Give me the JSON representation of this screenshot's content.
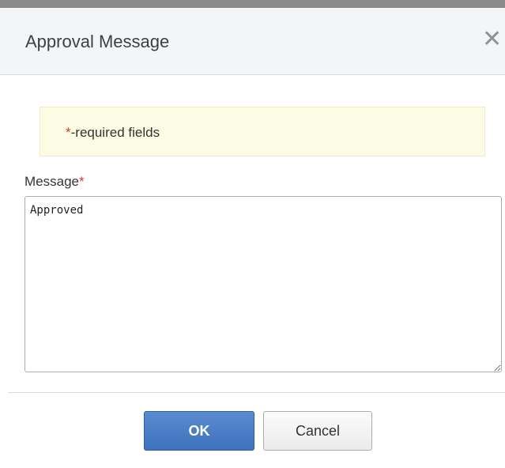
{
  "dialog": {
    "title": "Approval Message",
    "close_glyph": "✕",
    "close_icon": "close-icon"
  },
  "notice": {
    "asterisk": "*",
    "text": "-required fields"
  },
  "form": {
    "message_label": "Message",
    "required_marker": "*",
    "message_value": "Approved"
  },
  "buttons": {
    "ok_label": "OK",
    "cancel_label": "Cancel"
  },
  "colors": {
    "primary_button": "#4a7dc4",
    "required": "#e0332c",
    "notice_bg": "#fcfbe3"
  }
}
